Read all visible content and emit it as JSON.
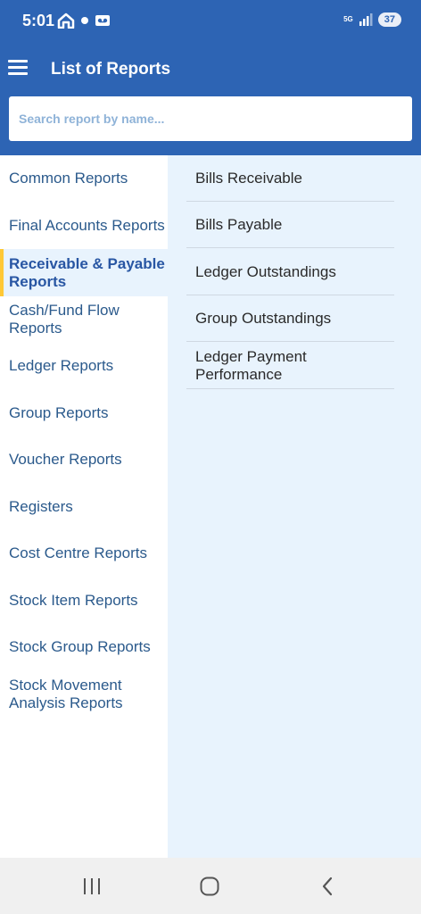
{
  "status_bar": {
    "time": "5:01",
    "network": "5G",
    "battery": "37"
  },
  "header": {
    "title": "List of Reports"
  },
  "search": {
    "placeholder": "Search report by name..."
  },
  "sidebar": {
    "items": [
      {
        "label": "Common Reports",
        "selected": false
      },
      {
        "label": "Final Accounts Reports",
        "selected": false
      },
      {
        "label": "Receivable & Payable Reports",
        "selected": true
      },
      {
        "label": "Cash/Fund Flow Reports",
        "selected": false
      },
      {
        "label": "Ledger Reports",
        "selected": false
      },
      {
        "label": "Group Reports",
        "selected": false
      },
      {
        "label": "Voucher Reports",
        "selected": false
      },
      {
        "label": "Registers",
        "selected": false
      },
      {
        "label": "Cost Centre Reports",
        "selected": false
      },
      {
        "label": "Stock Item Reports",
        "selected": false
      },
      {
        "label": "Stock Group Reports",
        "selected": false
      },
      {
        "label": "Stock Movement Analysis Reports",
        "selected": false
      }
    ]
  },
  "reports": {
    "items": [
      {
        "label": "Bills Receivable"
      },
      {
        "label": "Bills Payable"
      },
      {
        "label": "Ledger Outstandings"
      },
      {
        "label": "Group Outstandings"
      },
      {
        "label": "Ledger Payment Performance"
      }
    ]
  },
  "colors": {
    "header": "#2d64b4",
    "active_indicator": "#ffc835",
    "panel_bg": "#e8f3fd",
    "sidebar_text": "#2b5a8c"
  }
}
